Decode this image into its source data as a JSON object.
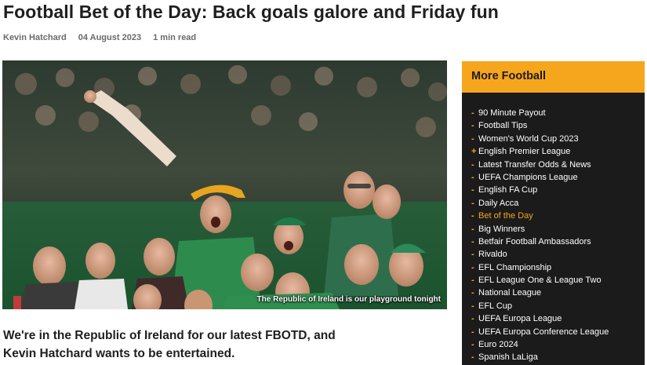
{
  "article": {
    "title": "Football Bet of the Day: Back goals galore and Friday fun",
    "author": "Kevin Hatchard",
    "date": "04 August 2023",
    "read_time": "1 min read",
    "image_caption": "The Republic of Ireland is our playground tonight",
    "standfirst_line1": "We're in the Republic of Ireland for our latest FBOTD, and",
    "standfirst_line2": "Kevin Hatchard wants to be entertained."
  },
  "sidebar": {
    "title": "More Football",
    "accent_color": "#f6a61d",
    "items": [
      {
        "label": "90 Minute Payout",
        "bullet": "-"
      },
      {
        "label": "Football Tips",
        "bullet": "-"
      },
      {
        "label": "Women's World Cup 2023",
        "bullet": "-"
      },
      {
        "label": "English Premier League",
        "bullet": "+"
      },
      {
        "label": "Latest Transfer Odds & News",
        "bullet": "-"
      },
      {
        "label": "UEFA Champions League",
        "bullet": "-"
      },
      {
        "label": "English FA Cup",
        "bullet": "-"
      },
      {
        "label": "Daily Acca",
        "bullet": "-"
      },
      {
        "label": "Bet of the Day",
        "bullet": "-",
        "active": true
      },
      {
        "label": "Big Winners",
        "bullet": "-"
      },
      {
        "label": "Betfair Football Ambassadors",
        "bullet": "-"
      },
      {
        "label": "Rivaldo",
        "bullet": "-"
      },
      {
        "label": "EFL Championship",
        "bullet": "-"
      },
      {
        "label": "EFL League One & League Two",
        "bullet": "-"
      },
      {
        "label": "National League",
        "bullet": "-"
      },
      {
        "label": "EFL Cup",
        "bullet": "-"
      },
      {
        "label": "UEFA Europa League",
        "bullet": "-"
      },
      {
        "label": "UEFA Europa Conference League",
        "bullet": "-"
      },
      {
        "label": "Euro 2024",
        "bullet": "-"
      },
      {
        "label": "Spanish LaLiga",
        "bullet": "-"
      }
    ]
  }
}
